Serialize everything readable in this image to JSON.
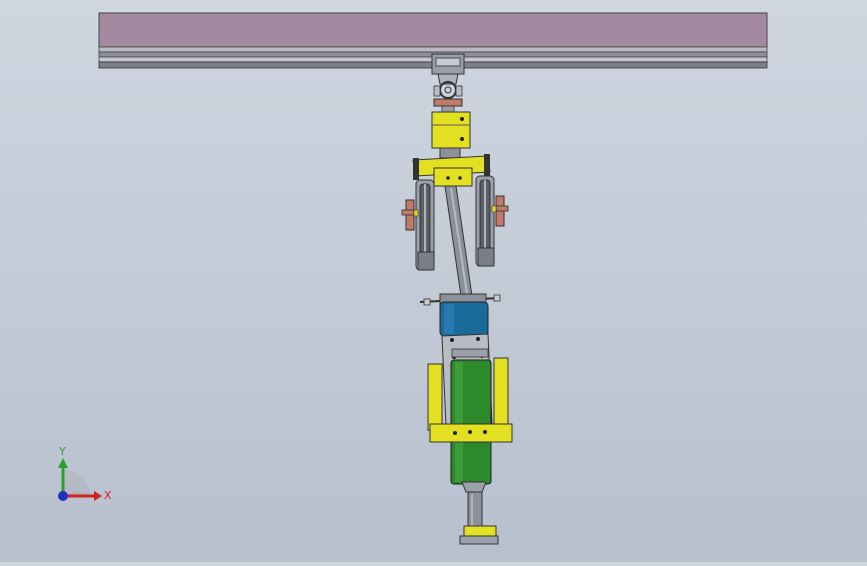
{
  "scene": {
    "colors": {
      "background_top": "#cfd6e0",
      "background_bottom": "#b7c0cd",
      "rail_top": "#a3899f",
      "rail_steel": "#8a8e96",
      "yellow_part": "#e3e022",
      "blue_part": "#1a6a9a",
      "green_part": "#2d8a2a",
      "steel_shaft": "#8c9098",
      "copper_part": "#c07a6a"
    },
    "triad": {
      "x_label": "X",
      "y_label": "Y",
      "x_color": "#d32020",
      "y_color": "#2aa02a",
      "z_color": "#2030c0"
    }
  }
}
